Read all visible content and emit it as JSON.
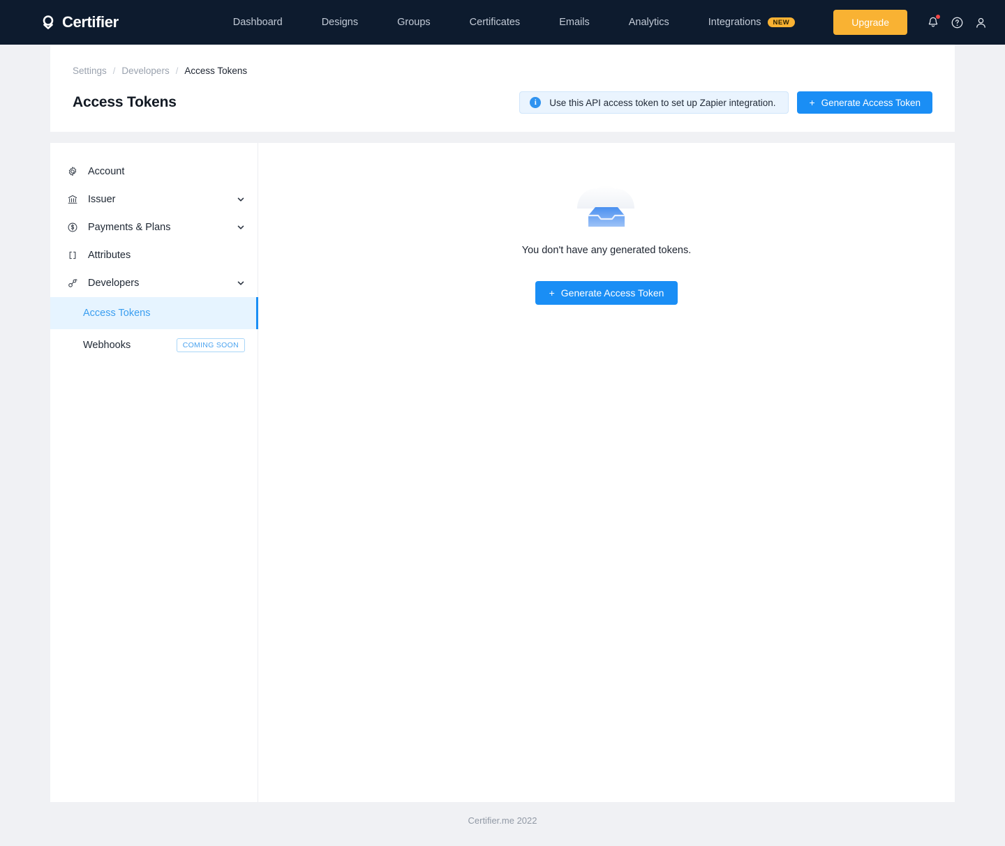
{
  "navbar": {
    "brand": "Certifier",
    "brand_icon": "certifier-logo-icon",
    "links": [
      {
        "label": "Dashboard"
      },
      {
        "label": "Designs"
      },
      {
        "label": "Groups"
      },
      {
        "label": "Certificates"
      },
      {
        "label": "Emails"
      },
      {
        "label": "Analytics"
      },
      {
        "label": "Integrations",
        "badge": "NEW"
      }
    ],
    "upgrade_label": "Upgrade",
    "icons": [
      {
        "name": "notifications-bell-icon",
        "has_dot": true
      },
      {
        "name": "help-circle-icon",
        "has_dot": false
      },
      {
        "name": "user-account-icon",
        "has_dot": false
      }
    ],
    "bg_color": "#0d1b2e",
    "upgrade_color": "#f9b233",
    "badge_color": "#f9b233",
    "notification_dot_color": "#f24646"
  },
  "header": {
    "breadcrumb": [
      {
        "label": "Settings",
        "current": false
      },
      {
        "label": "Developers",
        "current": false
      },
      {
        "label": "Access Tokens",
        "current": true
      }
    ],
    "breadcrumb_separator": "/",
    "title": "Access Tokens",
    "info_banner": {
      "icon": "info-circle-icon",
      "icon_glyph": "i",
      "text": "Use this API access token to set up Zapier integration.",
      "bg_color": "#eaf4fe",
      "border_color": "#cfe5fb"
    },
    "generate_button": {
      "plus": "+",
      "label": "Generate Access Token",
      "color": "#1a8ef5"
    }
  },
  "sidebar": {
    "items": [
      {
        "label": "Account",
        "icon": "gear-icon",
        "expandable": false
      },
      {
        "label": "Issuer",
        "icon": "bank-icon",
        "expandable": true
      },
      {
        "label": "Payments & Plans",
        "icon": "dollar-circle-icon",
        "expandable": true
      },
      {
        "label": "Attributes",
        "icon": "brackets-icon",
        "expandable": false
      },
      {
        "label": "Developers",
        "icon": "key-icon",
        "expandable": true
      }
    ],
    "sub_items": [
      {
        "label": "Access Tokens",
        "active": true,
        "badge": null
      },
      {
        "label": "Webhooks",
        "active": false,
        "badge": "COMING SOON"
      }
    ],
    "active_color": "#1a8ef5",
    "active_bg": "#e6f4ff"
  },
  "content": {
    "empty_illustration": "empty-box-icon",
    "empty_message": "You don't have any generated tokens.",
    "generate_button": {
      "plus": "+",
      "label": "Generate Access Token",
      "color": "#1a8ef5"
    }
  },
  "footer": {
    "text": "Certifier.me 2022"
  }
}
